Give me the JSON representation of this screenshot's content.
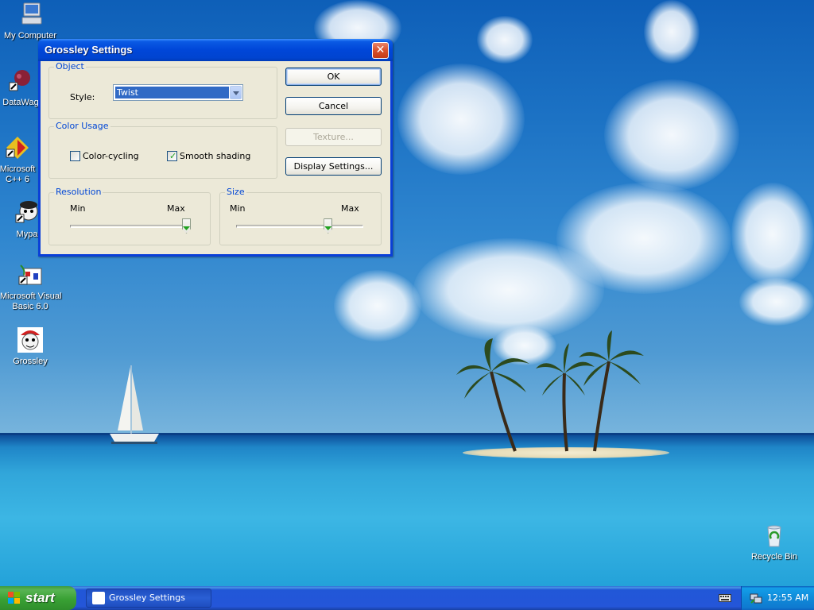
{
  "desktop": {
    "icons": [
      {
        "label": "My Computer"
      },
      {
        "label": "DataWag"
      },
      {
        "label": "Microsoft\nC++ 6"
      },
      {
        "label": "Mypa"
      },
      {
        "label": "Microsoft Visual\nBasic 6.0"
      },
      {
        "label": "Grossley"
      },
      {
        "label": "Recycle Bin"
      }
    ]
  },
  "dialog": {
    "title": "Grossley Settings",
    "close_glyph": "✕",
    "object_group": {
      "title": "Object",
      "style_label": "Style:",
      "style_value": "Twist"
    },
    "color_group": {
      "title": "Color Usage",
      "color_cycling": {
        "label": "Color-cycling",
        "checked": false
      },
      "smooth_shading": {
        "label": "Smooth shading",
        "checked": true
      }
    },
    "resolution_group": {
      "title": "Resolution",
      "min_label": "Min",
      "max_label": "Max",
      "value": 1.0
    },
    "size_group": {
      "title": "Size",
      "min_label": "Min",
      "max_label": "Max",
      "value": 0.74
    },
    "buttons": {
      "ok": "OK",
      "cancel": "Cancel",
      "texture": "Texture...",
      "display_settings": "Display Settings..."
    }
  },
  "taskbar": {
    "start_label": "start",
    "task_button": "Grossley Settings",
    "clock": "12:55 AM"
  },
  "colors": {
    "title_bar": "#0046d8",
    "dialog_face": "#ece9d8",
    "group_title": "#0046d5",
    "selection": "#316ac5",
    "checkmark": "#21a121",
    "start_button": "#39a134",
    "taskbar": "#2456d9"
  }
}
